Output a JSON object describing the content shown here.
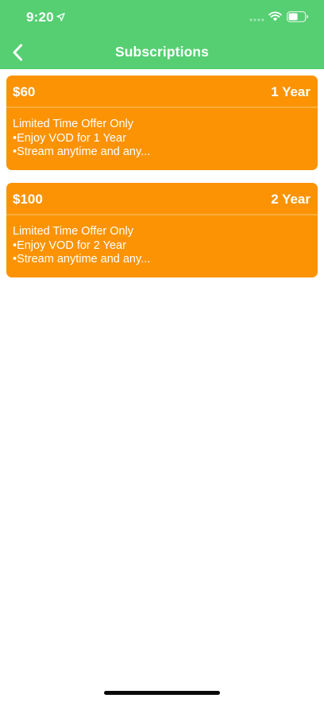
{
  "status_bar": {
    "time": "9:20",
    "icons": [
      "location-arrow-icon",
      "signal-icon",
      "wifi-icon",
      "battery-icon"
    ]
  },
  "nav": {
    "title": "Subscriptions",
    "back_icon": "chevron-left-icon"
  },
  "colors": {
    "header": "#55cf72",
    "card": "#fb9304",
    "card_divider": "#fdac3c",
    "text_on_color": "#ffffff"
  },
  "subscriptions": [
    {
      "price": "$60",
      "term": "1 Year",
      "lines": [
        "Limited Time Offer Only",
        "•Enjoy VOD for 1 Year",
        "•Stream anytime and any..."
      ]
    },
    {
      "price": "$100",
      "term": "2 Year",
      "lines": [
        "Limited Time Offer Only",
        "•Enjoy VOD for 2 Year",
        "•Stream anytime and any..."
      ]
    }
  ]
}
